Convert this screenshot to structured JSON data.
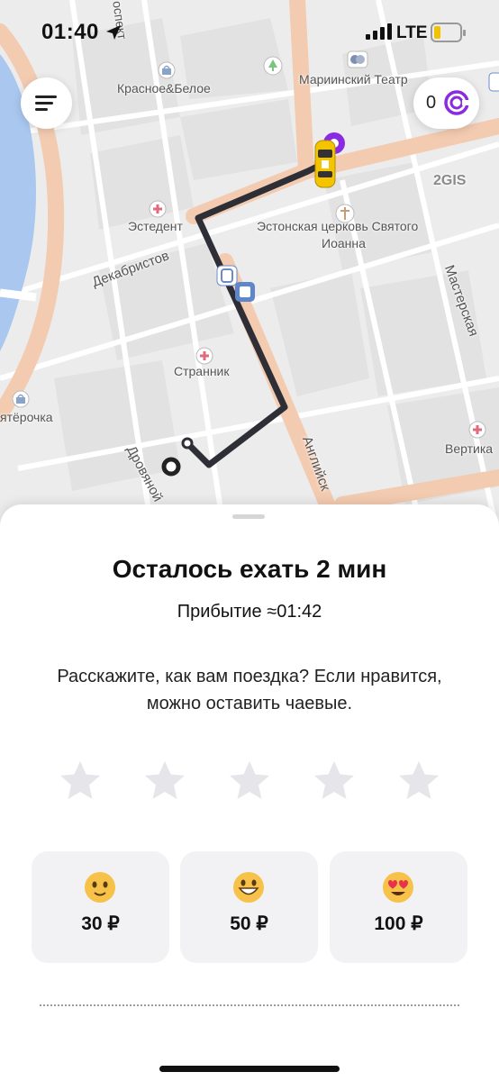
{
  "status_bar": {
    "time": "01:40",
    "network": "LTE"
  },
  "map": {
    "labels": {
      "prospect": "оспект",
      "krasnoe": "Красное&Белое",
      "mariinsky": "Мариинский Театр",
      "provider": "2GIS",
      "estedent": "Эстедент",
      "church_line1": "Эстонская церковь Святого",
      "church_line2": "Иоанна",
      "dekabristov": "Декабристов",
      "masterskaya": "Мастерская",
      "strannik": "Странник",
      "pyaterochka": "ятёрочка",
      "angliysky": "Английск",
      "vertika": "Вертика",
      "drovyanoy": "Дровяной"
    }
  },
  "header": {
    "coin_count": "0"
  },
  "sheet": {
    "title": "Осталось ехать 2 мин",
    "arrival": "Прибытие ≈01:42",
    "feedback_line1": "Расскажите, как вам поездка? Если нравится,",
    "feedback_line2": "можно оставить чаевые.",
    "stars_total": 5,
    "stars_selected": 0,
    "tips": [
      {
        "amount": "30 ₽",
        "emoji": "smiling-face-icon"
      },
      {
        "amount": "50 ₽",
        "emoji": "grinning-face-icon"
      },
      {
        "amount": "100 ₽",
        "emoji": "heart-eyes-face-icon"
      }
    ]
  },
  "colors": {
    "accent": "#8a2be2",
    "route": "#2e2e36",
    "major_road": "#f3cbb0",
    "river": "#a9c7ef",
    "car": "#f5c400",
    "star_inactive": "#e6e6ea"
  }
}
